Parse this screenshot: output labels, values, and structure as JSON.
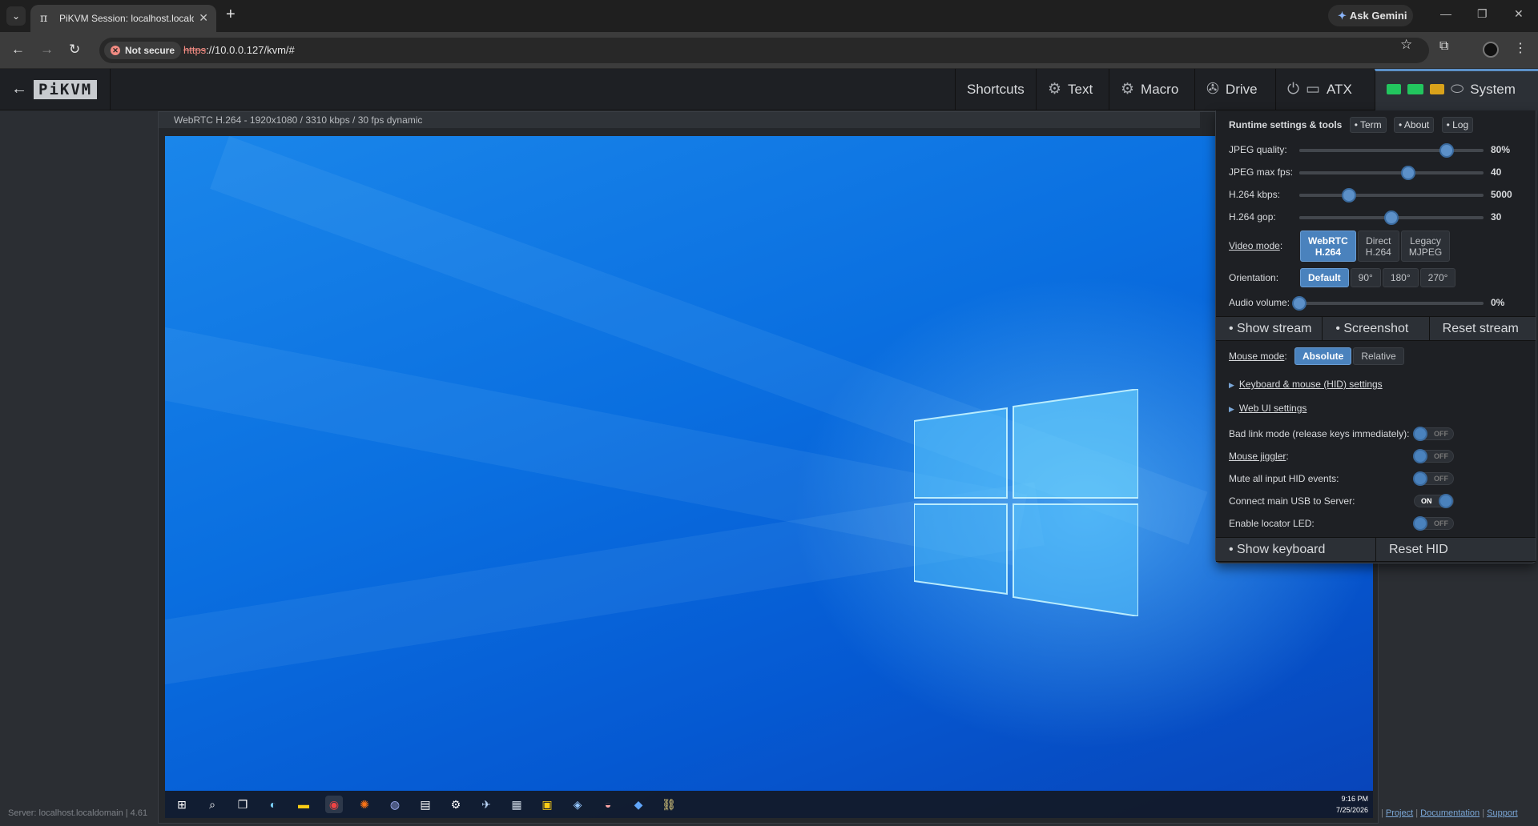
{
  "browser": {
    "tab_title": "PiKVM Session: localhost.localdomain",
    "security_label": "Not secure",
    "url_scheme": "https",
    "url_rest": "://10.0.0.127/kvm/#",
    "gemini_label": "Ask Gemini"
  },
  "navbar": {
    "shortcuts": "Shortcuts",
    "text": "Text",
    "macro": "Macro",
    "drive": "Drive",
    "atx": "ATX",
    "system": "System"
  },
  "stream": {
    "info": "WebRTC H.264 - 1920x1080 / 3310 kbps / 30 fps dynamic"
  },
  "taskbar": {
    "time": "9:16 PM",
    "date": "7/25/2026"
  },
  "footer": {
    "server": "Server: localhost.localdomain  |  4.61",
    "project": "Project",
    "documentation": "Documentation",
    "support": "Support"
  },
  "system_menu": {
    "title": "Runtime settings & tools",
    "term": "• Term",
    "about": "• About",
    "log": "• Log",
    "jpeg_quality": {
      "label": "JPEG quality:",
      "value": "80%",
      "fraction": 0.8
    },
    "jpeg_fps": {
      "label": "JPEG max fps:",
      "value": "40",
      "fraction": 0.59
    },
    "h264_kbps": {
      "label": "H.264 kbps:",
      "value": "5000",
      "fraction": 0.27
    },
    "h264_gop": {
      "label": "H.264 gop:",
      "value": "30",
      "fraction": 0.5
    },
    "video_mode": {
      "label": "Video mode",
      "options": [
        {
          "line1": "WebRTC",
          "line2": "H.264"
        },
        {
          "line1": "Direct",
          "line2": "H.264"
        },
        {
          "line1": "Legacy",
          "line2": "MJPEG"
        }
      ],
      "selected": 0
    },
    "orientation": {
      "label": "Orientation:",
      "options": [
        "Default",
        "90°",
        "180°",
        "270°"
      ],
      "selected": 0
    },
    "audio_volume": {
      "label": "Audio volume:",
      "value": "0%",
      "fraction": 0.0
    },
    "stream_buttons": [
      "• Show stream",
      "• Screenshot",
      "Reset stream"
    ],
    "mouse_mode": {
      "label": "Mouse mode",
      "options": [
        "Absolute",
        "Relative"
      ],
      "selected": 0
    },
    "hid_settings": "Keyboard & mouse (HID) settings",
    "web_ui_settings": "Web UI settings",
    "toggles": [
      {
        "label": "Bad link mode (release keys immediately):",
        "state": "OFF",
        "on": false,
        "underline": false
      },
      {
        "label": "Mouse jiggler",
        "suffix": ":",
        "state": "OFF",
        "on": false,
        "underline": true
      },
      {
        "label": "Mute all input HID events:",
        "state": "OFF",
        "on": false,
        "underline": false
      },
      {
        "label": "Connect main USB to Server:",
        "state": "ON",
        "on": true,
        "underline": false
      },
      {
        "label": "Enable locator LED:",
        "state": "OFF",
        "on": false,
        "underline": false
      }
    ],
    "bottom_buttons": [
      "• Show keyboard",
      "Reset HID"
    ]
  },
  "colors": {
    "accent": "#5c90c8",
    "selected": "#4a82bd",
    "led_green": "#22c55e",
    "led_yellow": "#d9a21b"
  }
}
